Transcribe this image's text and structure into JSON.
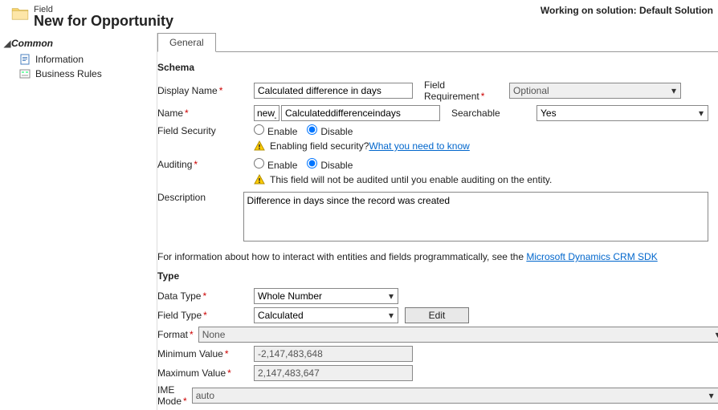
{
  "header": {
    "crumb": "Field",
    "title": "New for Opportunity",
    "solution": "Working on solution: Default Solution"
  },
  "sidebar": {
    "section": "Common",
    "items": [
      "Information",
      "Business Rules"
    ]
  },
  "tab": "General",
  "schema": {
    "heading": "Schema",
    "display_name_label": "Display Name",
    "display_name": "Calculated difference in days",
    "field_req_label": "Field Requirement",
    "field_req": "Optional",
    "name_label": "Name",
    "name_prefix": "new_",
    "name": "Calculateddifferenceindays",
    "searchable_label": "Searchable",
    "searchable": "Yes",
    "field_security_label": "Field Security",
    "enable_label": "Enable",
    "disable_label": "Disable",
    "fs_info_text": "Enabling field security? ",
    "fs_info_link": "What you need to know",
    "auditing_label": "Auditing",
    "audit_info": "This field will not be audited until you enable auditing on the entity.",
    "description_label": "Description",
    "description": "Difference in days since the record was created"
  },
  "sdk_text": "For information about how to interact with entities and fields programmatically, see the ",
  "sdk_link": "Microsoft Dynamics CRM SDK",
  "type": {
    "heading": "Type",
    "data_type_label": "Data Type",
    "data_type": "Whole Number",
    "field_type_label": "Field Type",
    "field_type": "Calculated",
    "edit_btn": "Edit",
    "format_label": "Format",
    "format": "None",
    "min_label": "Minimum Value",
    "min": "-2,147,483,648",
    "max_label": "Maximum Value",
    "max": "2,147,483,647",
    "ime_label": "IME Mode",
    "ime": "auto"
  }
}
